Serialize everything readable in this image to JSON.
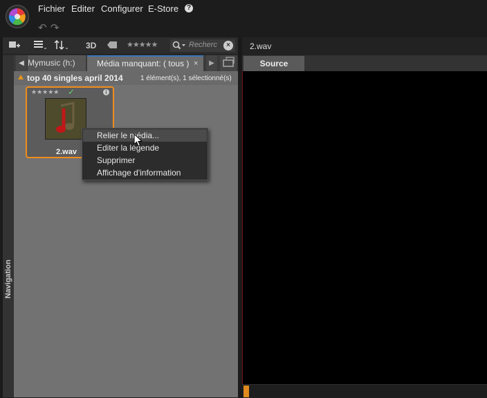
{
  "menu": {
    "items": [
      "Fichier",
      "Editer",
      "Configurer",
      "E-Store"
    ],
    "help_icon": "?"
  },
  "toolbar": {
    "view_3d": "3D",
    "rating_stars": "★★★★★",
    "search_placeholder": "Recherc"
  },
  "tabs": {
    "tab1_label": "Mymusic (h:)",
    "tab2_label": "Média manquant: ( tous )",
    "tab2_close": "×"
  },
  "sidebar": {
    "navigation_label": "Navigation"
  },
  "group": {
    "title": "top 40 singles april 2014",
    "count": "1 élément(s), 1 sélectionné(s)"
  },
  "media_item": {
    "name": "2.wav",
    "stars": "★★★★★",
    "check": "✓",
    "info": "i"
  },
  "context_menu": {
    "items": [
      "Relier le média...",
      "Editer la légende",
      "Supprimer",
      "Affichage d'information"
    ],
    "hover_index": 0
  },
  "preview": {
    "file_title": "2.wav",
    "source_tab": "Source"
  },
  "colors": {
    "accent_orange": "#f08e1d",
    "tab_active_border": "#3b73b9",
    "check_green": "#5fd070"
  }
}
